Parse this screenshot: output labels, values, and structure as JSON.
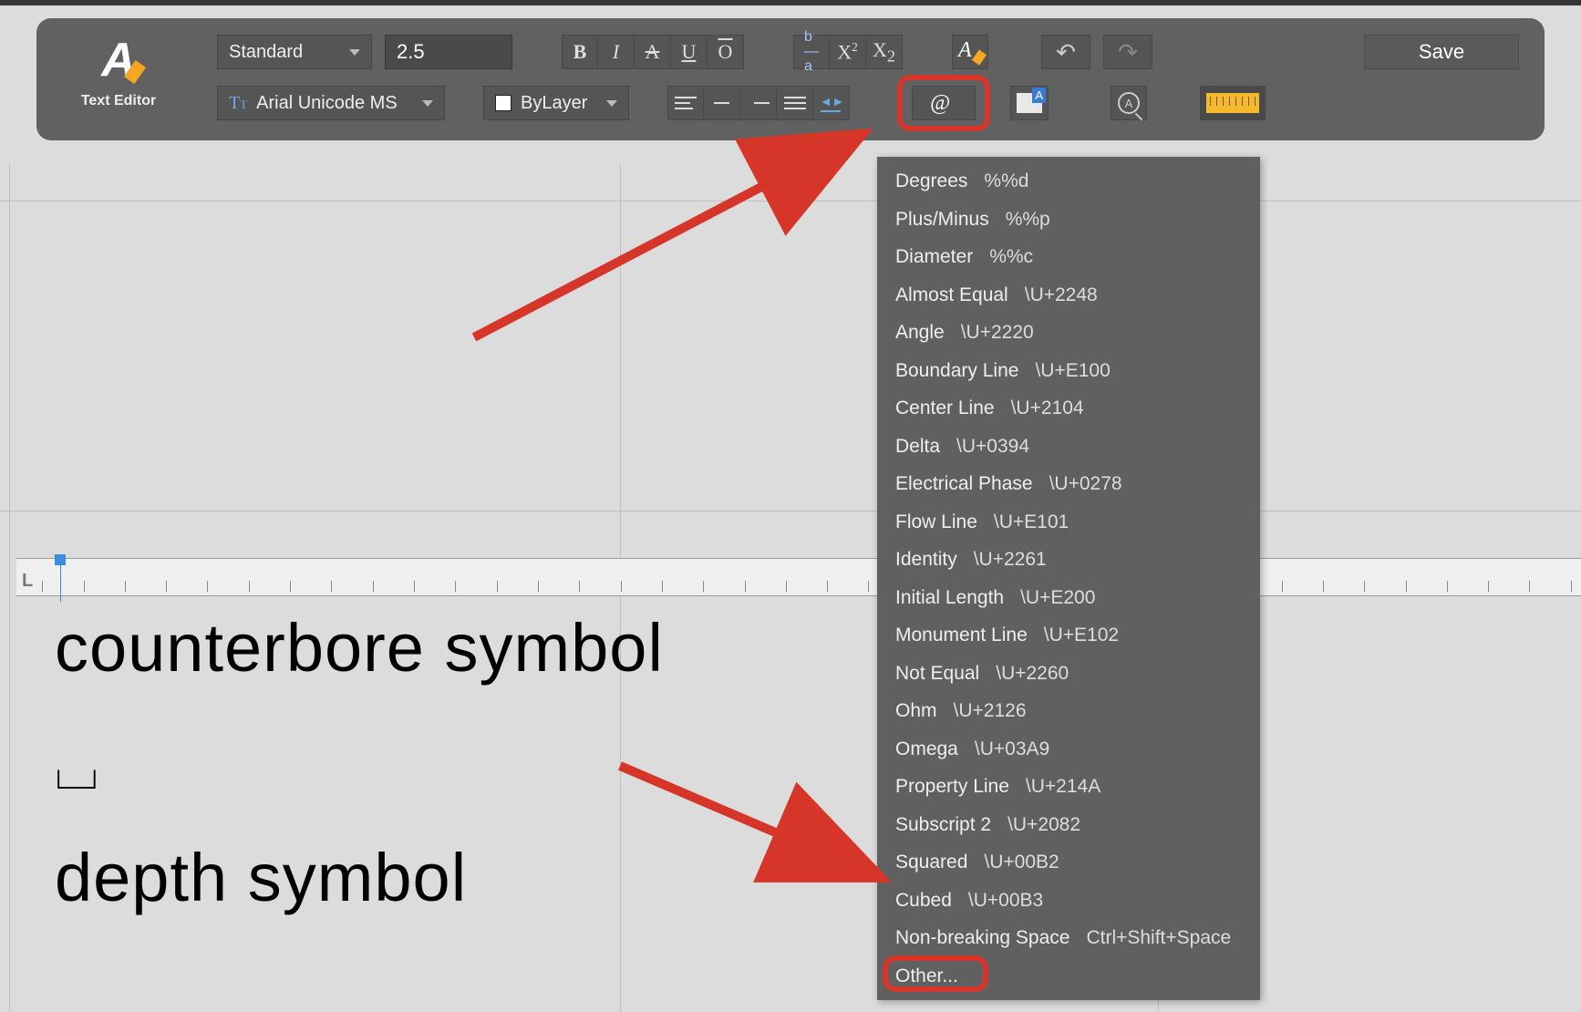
{
  "editor_label": "Text Editor",
  "toolbar": {
    "style": "Standard",
    "height": "2.5",
    "font": "Arial Unicode MS",
    "color_layer": "ByLayer",
    "save": "Save",
    "symbol_glyph": "@"
  },
  "format_icons": {
    "bold": "B",
    "italic": "I",
    "strike": "A",
    "under": "U",
    "over": "O",
    "frac_top": "b",
    "frac_bot": "a",
    "sup": "X",
    "sup2": "2",
    "sub": "X",
    "sub2": "2"
  },
  "symbol_menu": [
    {
      "name": "Degrees",
      "code": "%%d"
    },
    {
      "name": "Plus/Minus",
      "code": "%%p"
    },
    {
      "name": "Diameter",
      "code": "%%c"
    },
    {
      "name": "Almost Equal",
      "code": "\\U+2248"
    },
    {
      "name": "Angle",
      "code": "\\U+2220"
    },
    {
      "name": "Boundary Line",
      "code": "\\U+E100"
    },
    {
      "name": "Center Line",
      "code": "\\U+2104"
    },
    {
      "name": "Delta",
      "code": "\\U+0394"
    },
    {
      "name": "Electrical Phase",
      "code": "\\U+0278"
    },
    {
      "name": "Flow Line",
      "code": "\\U+E101"
    },
    {
      "name": "Identity",
      "code": "\\U+2261"
    },
    {
      "name": "Initial Length",
      "code": "\\U+E200"
    },
    {
      "name": "Monument Line",
      "code": "\\U+E102"
    },
    {
      "name": "Not Equal",
      "code": "\\U+2260"
    },
    {
      "name": "Ohm",
      "code": "\\U+2126"
    },
    {
      "name": "Omega",
      "code": "\\U+03A9"
    },
    {
      "name": "Property Line",
      "code": "\\U+214A"
    },
    {
      "name": "Subscript 2",
      "code": "\\U+2082"
    },
    {
      "name": "Squared",
      "code": "\\U+00B2"
    },
    {
      "name": "Cubed",
      "code": "\\U+00B3"
    },
    {
      "name": "Non-breaking Space",
      "code": "Ctrl+Shift+Space"
    },
    {
      "name": "Other...",
      "code": ""
    }
  ],
  "canvas": {
    "line1": "counterbore symbol",
    "line2": "⌴",
    "line3": "depth symbol"
  },
  "ruler_marker": "L"
}
